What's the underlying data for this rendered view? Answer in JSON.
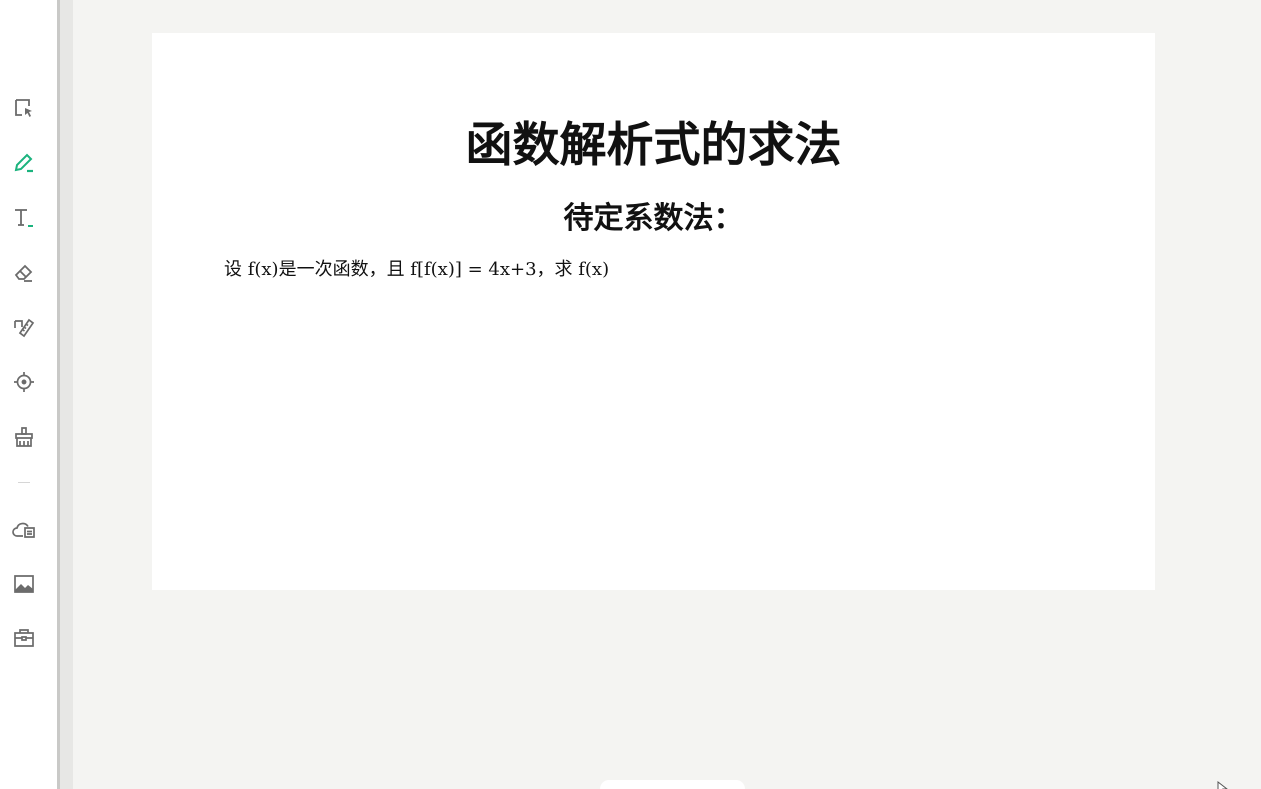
{
  "toolbar": {
    "tools": [
      {
        "name": "select-tool",
        "icon": "select-arrow-icon"
      },
      {
        "name": "pen-tool",
        "icon": "pen-icon",
        "active": true
      },
      {
        "name": "text-tool",
        "icon": "text-icon"
      },
      {
        "name": "eraser-tool",
        "icon": "eraser-icon"
      },
      {
        "name": "ruler-tool",
        "icon": "ruler-icon"
      },
      {
        "name": "laser-pointer-tool",
        "icon": "crosshair-icon"
      },
      {
        "name": "clear-tool",
        "icon": "broom-icon"
      },
      {
        "name": "cloud-files-tool",
        "icon": "cloud-folder-icon"
      },
      {
        "name": "image-tool",
        "icon": "image-icon"
      },
      {
        "name": "toolbox-tool",
        "icon": "toolbox-icon"
      }
    ],
    "accent_color": "#1bb37e",
    "icon_color": "#6b6b6b"
  },
  "page": {
    "title": "函数解析式的求法",
    "section_heading": "待定系数法：",
    "problem": "设 f(x)是一次函数，且 f[f(x)] = 4x+3，求 f(x)"
  },
  "colors": {
    "background": "#f4f4f2",
    "page": "#ffffff",
    "text": "#111111"
  }
}
